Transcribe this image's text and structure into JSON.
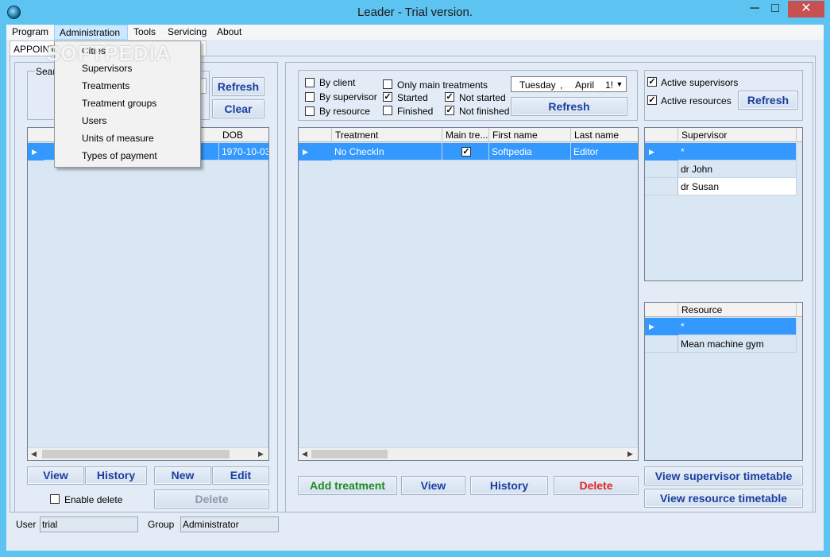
{
  "window": {
    "title": "Leader - Trial version.",
    "minimize": "─",
    "maximize": "□",
    "close": "✕"
  },
  "menu": {
    "items": [
      "Program",
      "Administration",
      "Tools",
      "Servicing",
      "About"
    ],
    "active_index": 1,
    "dropdown": [
      "Cities",
      "Supervisors",
      "Treatments",
      "Treatment groups",
      "Users",
      "Units of measure",
      "Types of payment"
    ]
  },
  "tab": {
    "label": "APPOINTM"
  },
  "watermark": "SOFTPEDIA",
  "left": {
    "search_group_label": "Searc",
    "refresh": "Refresh",
    "clear": "Clear",
    "grid": {
      "columns": [
        "DOB"
      ],
      "rows": [
        {
          "dob": "1970-10-03"
        }
      ]
    },
    "buttons": {
      "view": "View",
      "history": "History",
      "new": "New",
      "edit": "Edit",
      "delete": "Delete"
    },
    "enable_delete": "Enable delete"
  },
  "filters": {
    "by_client": "By client",
    "by_supervisor": "By supervisor",
    "by_resource": "By resource",
    "only_main": "Only main treatments",
    "started": "Started",
    "finished": "Finished",
    "not_started": "Not started",
    "not_finished": "Not finished",
    "date_day": "Tuesday",
    "date_sep": ",",
    "date_month": "April",
    "date_partial": "1!",
    "refresh": "Refresh",
    "checked": {
      "by_client": false,
      "by_supervisor": false,
      "by_resource": false,
      "only_main": false,
      "started": true,
      "finished": false,
      "not_started": true,
      "not_finished": true
    }
  },
  "treatments": {
    "columns": [
      "Treatment",
      "Main tre...",
      "First name",
      "Last name"
    ],
    "rows": [
      {
        "treatment": "No CheckIn",
        "main": true,
        "first": "Softpedia",
        "last": "Editor"
      }
    ],
    "buttons": {
      "add": "Add treatment",
      "view": "View",
      "history": "History",
      "delete": "Delete"
    }
  },
  "right": {
    "active_supervisors": "Active supervisors",
    "active_resources": "Active resources",
    "refresh": "Refresh",
    "supervisor_grid": {
      "column": "Supervisor",
      "rows": [
        "*",
        "dr John",
        "dr Susan"
      ]
    },
    "resource_grid": {
      "column": "Resource",
      "rows": [
        "*",
        "Mean machine gym"
      ]
    },
    "view_supervisor_timetable": "View supervisor timetable",
    "view_resource_timetable": "View resource timetable"
  },
  "status": {
    "user_label": "User",
    "user_value": "trial",
    "group_label": "Group",
    "group_value": "Administrator"
  },
  "colors": {
    "titlebar": "#5dc3f0",
    "selection": "#3399ff",
    "link_blue": "#1b3e9f",
    "green": "#1e8c1e",
    "red": "#e0241e"
  }
}
